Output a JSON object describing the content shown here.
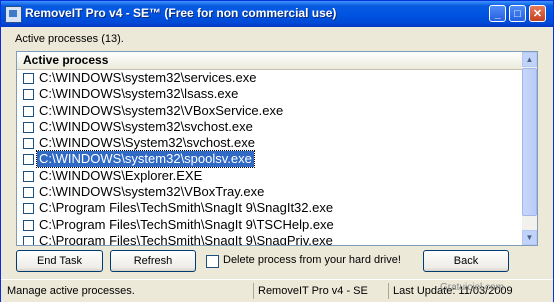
{
  "window": {
    "title": "RemoveIT Pro v4 - SE™ (Free for non commercial use)",
    "minimize_glyph": "_",
    "maximize_glyph": "□",
    "close_glyph": "✕"
  },
  "processes_label": "Active processes (13).",
  "list": {
    "column_header": "Active process",
    "rows": [
      {
        "path": "C:\\WINDOWS\\system32\\services.exe",
        "checked": false
      },
      {
        "path": "C:\\WINDOWS\\system32\\lsass.exe",
        "checked": false
      },
      {
        "path": "C:\\WINDOWS\\system32\\VBoxService.exe",
        "checked": false
      },
      {
        "path": "C:\\WINDOWS\\system32\\svchost.exe",
        "checked": false
      },
      {
        "path": "C:\\WINDOWS\\System32\\svchost.exe",
        "checked": false
      },
      {
        "path": "C:\\WINDOWS\\system32\\spoolsv.exe",
        "checked": false,
        "selected": true
      },
      {
        "path": "C:\\WINDOWS\\Explorer.EXE",
        "checked": false
      },
      {
        "path": "C:\\WINDOWS\\system32\\VBoxTray.exe",
        "checked": false
      },
      {
        "path": "C:\\Program Files\\TechSmith\\SnagIt 9\\SnagIt32.exe",
        "checked": false
      },
      {
        "path": "C:\\Program Files\\TechSmith\\SnagIt 9\\TSCHelp.exe",
        "checked": false
      },
      {
        "path": "C:\\Program Files\\TechSmith\\SnagIt 9\\SnagPriv.exe",
        "checked": false
      }
    ],
    "scroll_up_glyph": "▲",
    "scroll_down_glyph": "▼"
  },
  "buttons": {
    "end_task": "End Task",
    "refresh": "Refresh",
    "back": "Back"
  },
  "delete_option": {
    "label": "Delete process from your hard drive!",
    "checked": false
  },
  "status": {
    "message": "Manage active processes.",
    "product": "RemoveIT Pro v4 -  SE",
    "last_update": "Last Update: 11/03/2009"
  },
  "watermark": "Gratuiciel.com"
}
